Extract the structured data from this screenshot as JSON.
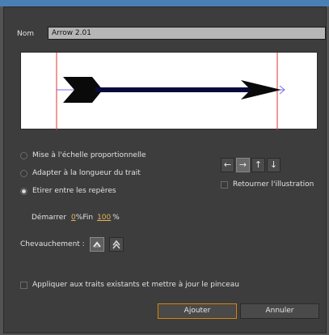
{
  "name_field": {
    "label": "Nom",
    "value": "Arrow 2.01"
  },
  "scale_options": [
    {
      "label": "Mise à l'échelle proportionnelle",
      "selected": false
    },
    {
      "label": "Adapter à la longueur du trait",
      "selected": false
    },
    {
      "label": "Etirer entre les repères",
      "selected": true
    }
  ],
  "flip": {
    "buttons": [
      {
        "icon": "arrow-left-icon",
        "glyph": "←"
      },
      {
        "icon": "arrow-right-icon",
        "glyph": "→"
      },
      {
        "icon": "arrow-up-icon",
        "glyph": "↑"
      },
      {
        "icon": "arrow-down-icon",
        "glyph": "↓"
      }
    ],
    "reverse_label": "Retourner l'illustration"
  },
  "range": {
    "start_label": "Démarrer",
    "start_value": "0",
    "start_unit": "%",
    "end_label": "Fin",
    "end_value": "100",
    "end_unit": "%"
  },
  "overlap": {
    "label": "Chevauchement :"
  },
  "apply_label": "Appliquer aux traits existants et mettre à jour le pinceau",
  "buttons": {
    "add": "Ajouter",
    "cancel": "Annuler"
  },
  "colors": {
    "dialog_bg": "#3d3d3d",
    "guide": "#e53030",
    "stroke": "#0a0a3a",
    "default_button_border": "#c88a2a"
  }
}
